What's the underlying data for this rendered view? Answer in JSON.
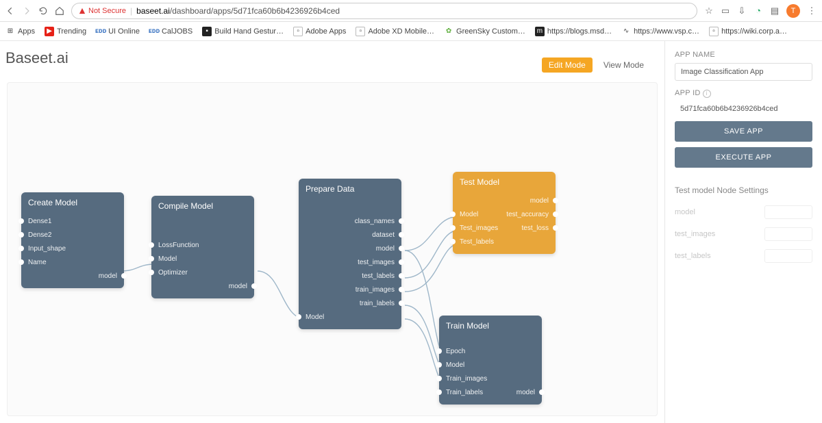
{
  "browser": {
    "not_secure": "Not Secure",
    "url_host": "baseet.ai",
    "url_path": "/dashboard/apps/5d71fca60b6b4236926b4ced",
    "avatar_letter": "T"
  },
  "bookmarks": [
    {
      "label": "Apps",
      "icon": "apps"
    },
    {
      "label": "Trending",
      "icon": "youtube"
    },
    {
      "label": "UI Online",
      "icon": "text-blue"
    },
    {
      "label": "CalJOBS",
      "icon": "text-blue"
    },
    {
      "label": "Build Hand Gestur…",
      "icon": "dark"
    },
    {
      "label": "Adobe Apps",
      "icon": "doc"
    },
    {
      "label": "Adobe XD Mobile…",
      "icon": "doc"
    },
    {
      "label": "GreenSky Custom…",
      "icon": "green"
    },
    {
      "label": "https://blogs.msd…",
      "icon": "dark"
    },
    {
      "label": "https://www.vsp.c…",
      "icon": "plain"
    },
    {
      "label": "https://wiki.corp.a…",
      "icon": "doc"
    }
  ],
  "app": {
    "brand": "Baseet.ai",
    "mode_edit": "Edit Mode",
    "mode_view": "View Mode"
  },
  "nodes": {
    "create_model": {
      "title": "Create Model",
      "inputs": [
        "Dense1",
        "Dense2",
        "Input_shape",
        "Name"
      ],
      "outputs": [
        "model"
      ]
    },
    "compile_model": {
      "title": "Compile Model",
      "inputs": [
        "LossFunction",
        "Model",
        "Optimizer"
      ],
      "outputs": [
        "model"
      ]
    },
    "prepare_data": {
      "title": "Prepare Data",
      "inputs": [
        "Model"
      ],
      "outputs": [
        "class_names",
        "dataset",
        "model",
        "test_images",
        "test_labels",
        "train_images",
        "train_labels"
      ]
    },
    "test_model": {
      "title": "Test Model",
      "inputs": [
        "Model",
        "Test_images",
        "Test_labels"
      ],
      "outputs": [
        "model",
        "test_accuracy",
        "test_loss"
      ]
    },
    "train_model": {
      "title": "Train Model",
      "inputs": [
        "Epoch",
        "Model",
        "Train_images",
        "Train_labels"
      ],
      "outputs": [
        "model"
      ]
    }
  },
  "sidebar": {
    "app_name_label": "APP NAME",
    "app_name_value": "Image Classification App",
    "app_id_label": "APP ID",
    "app_id_value": "5d71fca60b6b4236926b4ced",
    "save_btn": "SAVE APP",
    "execute_btn": "EXECUTE APP",
    "node_settings_title": "Test model Node Settings",
    "settings": [
      "model",
      "test_images",
      "test_labels"
    ]
  }
}
